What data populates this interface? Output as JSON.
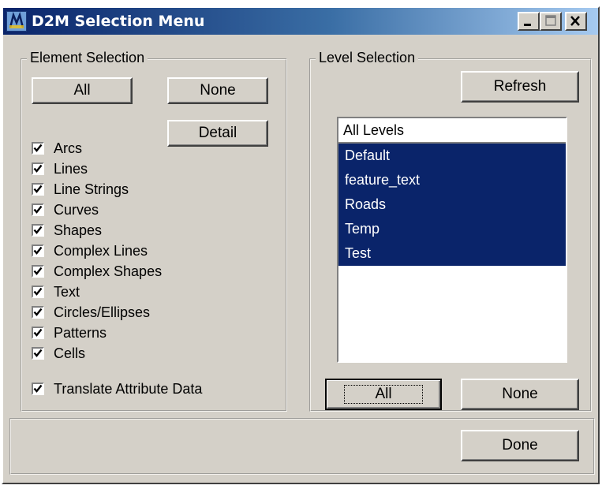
{
  "window": {
    "title": "D2M Selection Menu"
  },
  "titlebar_buttons": {
    "minimize": "minimize-icon",
    "maximize": "maximize-icon",
    "close": "close-icon"
  },
  "element_selection": {
    "legend": "Element Selection",
    "all_label": "All",
    "none_label": "None",
    "detail_label": "Detail",
    "items": [
      {
        "label": "Arcs",
        "checked": true
      },
      {
        "label": "Lines",
        "checked": true
      },
      {
        "label": "Line Strings",
        "checked": true
      },
      {
        "label": "Curves",
        "checked": true
      },
      {
        "label": "Shapes",
        "checked": true
      },
      {
        "label": "Complex Lines",
        "checked": true
      },
      {
        "label": "Complex Shapes",
        "checked": true
      },
      {
        "label": "Text",
        "checked": true
      },
      {
        "label": "Circles/Ellipses",
        "checked": true
      },
      {
        "label": "Patterns",
        "checked": true
      },
      {
        "label": "Cells",
        "checked": true
      }
    ],
    "translate_attribute": {
      "label": "Translate Attribute Data",
      "checked": true
    }
  },
  "level_selection": {
    "legend": "Level Selection",
    "refresh_label": "Refresh",
    "list_header": "All Levels",
    "levels": [
      {
        "label": "Default",
        "selected": true
      },
      {
        "label": "feature_text",
        "selected": true
      },
      {
        "label": "Roads",
        "selected": true
      },
      {
        "label": "Temp",
        "selected": true
      },
      {
        "label": "Test",
        "selected": true
      }
    ],
    "all_label": "All",
    "none_label": "None"
  },
  "footer": {
    "done_label": "Done"
  },
  "colors": {
    "face": "#d4d0c8",
    "selection": "#0a246a",
    "title_start": "#0a246a",
    "title_end": "#a6caf0"
  }
}
